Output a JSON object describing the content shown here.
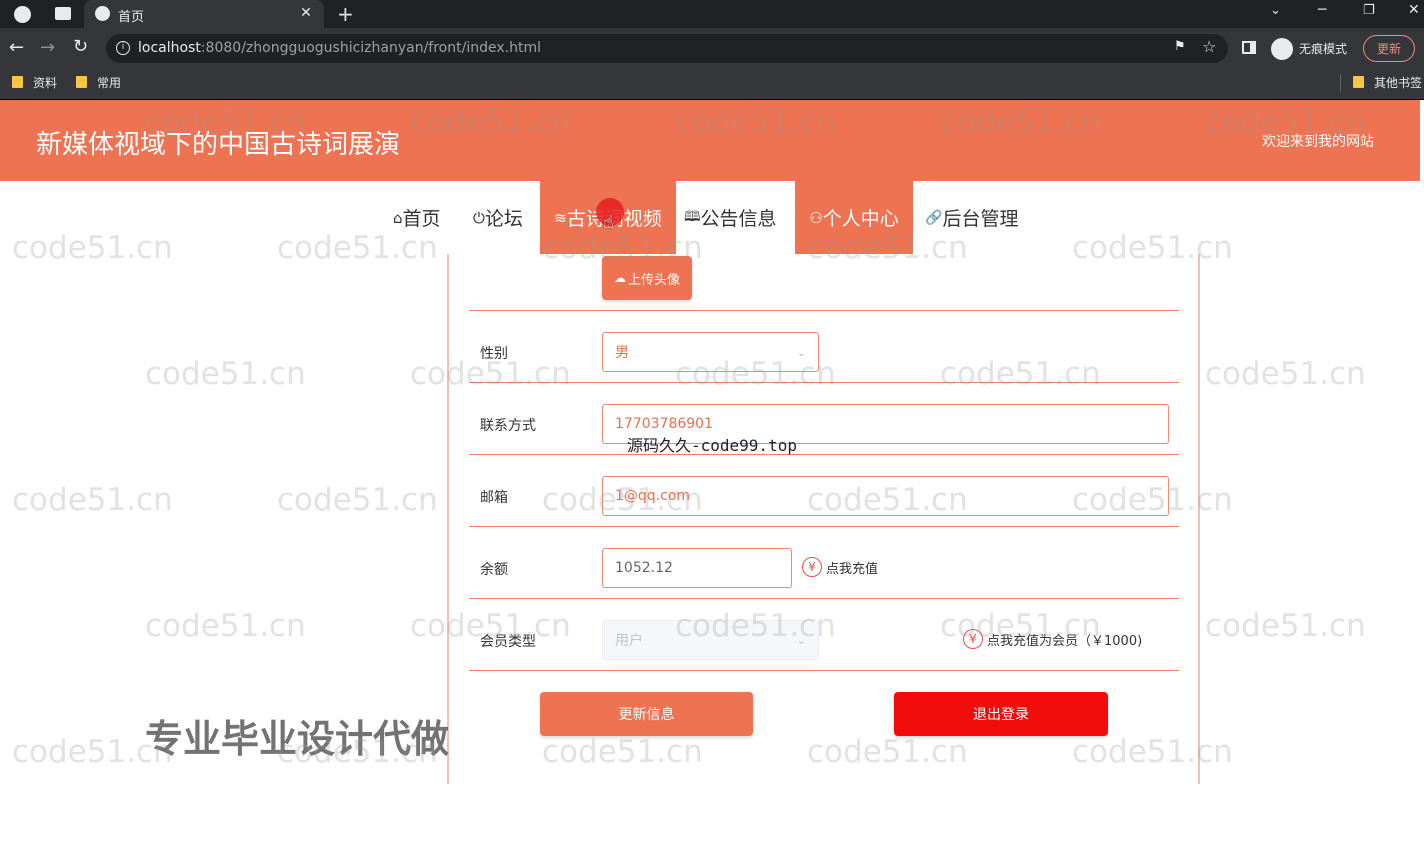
{
  "browser": {
    "tab_title": "首页",
    "url_host": "localhost",
    "url_rest": ":8080/zhongguogushicizhanyan/front/index.html",
    "incognito_label": "无痕模式",
    "update_label": "更新",
    "bookmarks": [
      "资料",
      "常用"
    ],
    "other_bookmarks": "其他书签"
  },
  "site": {
    "title": "新媒体视域下的中国古诗词展演",
    "welcome": "欢迎来到我的网站"
  },
  "nav": {
    "items": [
      {
        "icon": "⌂",
        "label": "首页"
      },
      {
        "icon": "⏻",
        "label": "论坛"
      },
      {
        "icon": "≋",
        "label": "古诗词视频"
      },
      {
        "icon": "🕮",
        "label": "公告信息"
      },
      {
        "icon": "⚇",
        "label": "个人中心"
      },
      {
        "icon": "🔗",
        "label": "后台管理"
      }
    ]
  },
  "profile": {
    "upload_avatar": "上传头像",
    "gender_label": "性别",
    "gender_value": "男",
    "contact_label": "联系方式",
    "contact_value": "17703786901",
    "email_label": "邮箱",
    "email_value": "1@qq.com",
    "balance_label": "余额",
    "balance_value": "1052.12",
    "recharge_label": "点我充值",
    "member_type_label": "会员类型",
    "member_type_value": "用户",
    "vip_recharge_label": "点我充值为会员（￥1000)",
    "update_button": "更新信息",
    "logout_button": "退出登录"
  },
  "overlays": {
    "source_text": "源码久久-code99.top",
    "ad_text": "专业毕业设计代做",
    "watermark": "code51.cn"
  },
  "colors": {
    "brand": "#ed7353",
    "logout": "#f20d0d"
  }
}
